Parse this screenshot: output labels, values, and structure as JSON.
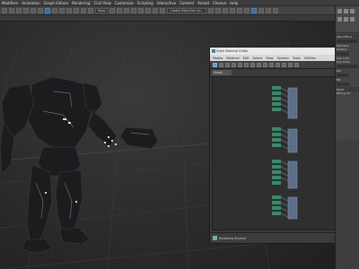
{
  "menubar": {
    "items": [
      "Modifiers",
      "Animation",
      "Graph Editors",
      "Rendering",
      "Civil View",
      "Customize",
      "Scripting",
      "Interactive",
      "Content",
      "Arnold",
      "Cheeva",
      "Help"
    ]
  },
  "toolbar": {
    "view_dropdown": "View",
    "selection_set_dropdown": "Create Selection Se..."
  },
  "slate": {
    "title": "Slate Material Editor",
    "menu": [
      "Modes",
      "Material",
      "Edit",
      "Select",
      "View",
      "Options",
      "Tools",
      "Utilities"
    ],
    "view_tab": "View1",
    "status_text": "Rendering finished"
  },
  "command_panel": {
    "section_title": "Skin FFD (1",
    "label_1": "Standard",
    "label_2": "Position",
    "label_3": "Sub Anim",
    "label_4": "Key mode",
    "label_5": "Rot",
    "label_6": "Mtl",
    "section_2": "Modif",
    "label_7": "Mtl Cyl Ch"
  },
  "colors": {
    "accent_blue": "#2f6fa6",
    "node_green": "#2f8f6a",
    "node_header": "#5a6e8a"
  }
}
